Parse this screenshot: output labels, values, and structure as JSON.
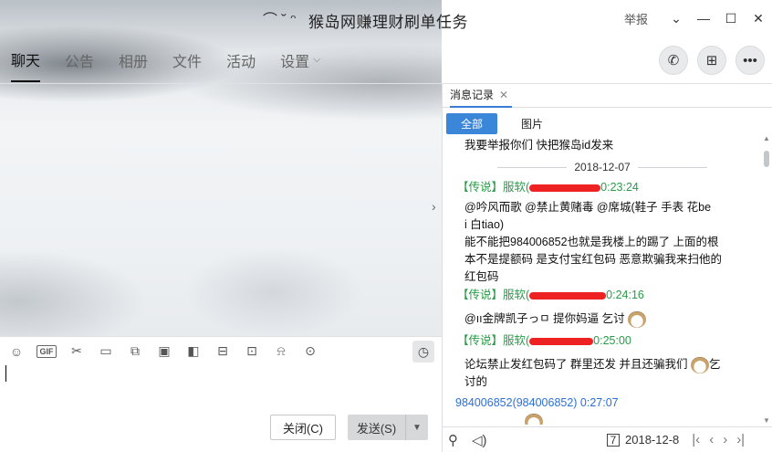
{
  "window": {
    "title": "猴岛网赚理财刷单任务",
    "report": "举报"
  },
  "tabs": [
    {
      "label": "聊天"
    },
    {
      "label": "公告"
    },
    {
      "label": "相册"
    },
    {
      "label": "文件"
    },
    {
      "label": "活动"
    },
    {
      "label": "设置"
    }
  ],
  "input": {
    "close_label": "关闭(C)",
    "send_label": "发送(S)"
  },
  "history": {
    "tab_label": "消息记录",
    "filters": [
      "全部",
      "图片"
    ],
    "messages": {
      "m1": "我要举报你们 快把猴岛id发来",
      "date1": "2018-12-07",
      "meta1_prefix": "【传说】服软(",
      "meta1_time": "0:23:24",
      "m2_l1": "@吟风而歌 @禁止黄赌毒 @席城(鞋子 手表 花be",
      "m2_l2": "i 白tiao)",
      "m2_l3": "能不能把984006852也就是我楼上的踢了 上面的根",
      "m2_l4": "本不是提额码 是支付宝红包码 恶意欺骗我来扫他的",
      "m2_l5": "红包码",
      "meta2_prefix": "【传说】服软(",
      "meta2_time": "0:24:16",
      "m3": "@ıı金牌凯子っㅁ 提你妈逼 乞讨",
      "meta3_prefix": "【传说】服软(",
      "meta3_time": "0:25:00",
      "m4_l1": "论坛禁止发红包码了 群里还发 并且还骗我们",
      "m4_l1_end": "乞",
      "m4_l2": "讨的",
      "meta4": "984006852(984006852) 0:27:07"
    },
    "bottom_date": "2018-12-8"
  }
}
